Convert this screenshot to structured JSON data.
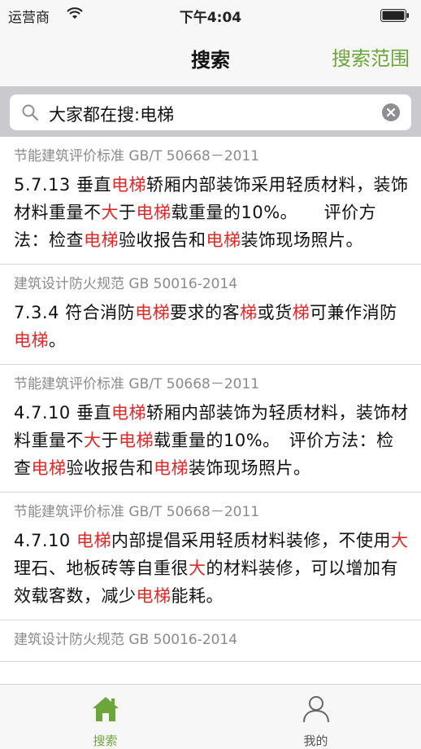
{
  "status": {
    "carrier": "运营商",
    "time": "下午4:04"
  },
  "nav": {
    "title": "搜索",
    "scope_button": "搜索范围"
  },
  "search": {
    "value": "大家都在搜:电梯"
  },
  "results": [
    {
      "source": "节能建筑评价标准 GB/T 50668－2011",
      "segments": [
        {
          "t": "5.7.13 垂直"
        },
        {
          "t": "电梯",
          "h": 1
        },
        {
          "t": "轿厢内部装饰采用轻质材料，装饰材料重量不"
        },
        {
          "t": "大",
          "h": 1
        },
        {
          "t": "于"
        },
        {
          "t": "电梯",
          "h": 1
        },
        {
          "t": "载重量的10%。　　评价方法：检查"
        },
        {
          "t": "电梯",
          "h": 1
        },
        {
          "t": "验收报告和"
        },
        {
          "t": "电梯",
          "h": 1
        },
        {
          "t": "装饰现场照片。"
        }
      ]
    },
    {
      "source": "建筑设计防火规范 GB 50016-2014",
      "segments": [
        {
          "t": "7.3.4 符合消防"
        },
        {
          "t": "电梯",
          "h": 1
        },
        {
          "t": "要求的客"
        },
        {
          "t": "梯",
          "h": 1
        },
        {
          "t": "或货"
        },
        {
          "t": "梯",
          "h": 1
        },
        {
          "t": "可兼作消防"
        },
        {
          "t": "电梯",
          "h": 1
        },
        {
          "t": "。"
        }
      ]
    },
    {
      "source": "节能建筑评价标准 GB/T 50668－2011",
      "segments": [
        {
          "t": "4.7.10 垂直"
        },
        {
          "t": "电梯",
          "h": 1
        },
        {
          "t": "轿厢内部装饰为轻质材料，装饰材料重量不"
        },
        {
          "t": "大",
          "h": 1
        },
        {
          "t": "于"
        },
        {
          "t": "电梯",
          "h": 1
        },
        {
          "t": "载重量的10%。　评价方法：检查"
        },
        {
          "t": "电梯",
          "h": 1
        },
        {
          "t": "验收报告和"
        },
        {
          "t": "电梯",
          "h": 1
        },
        {
          "t": "装饰现场照片。"
        }
      ]
    },
    {
      "source": "节能建筑评价标准 GB/T 50668－2011",
      "segments": [
        {
          "t": "4.7.10 "
        },
        {
          "t": "电梯",
          "h": 1
        },
        {
          "t": "内部提倡采用轻质材料装修，不使用"
        },
        {
          "t": "大",
          "h": 1
        },
        {
          "t": "理石、地板砖等自重很"
        },
        {
          "t": "大",
          "h": 1
        },
        {
          "t": "的材料装修，可以增加有效载客数，减少"
        },
        {
          "t": "电梯",
          "h": 1
        },
        {
          "t": "能耗。"
        }
      ]
    },
    {
      "source": "建筑设计防火规范 GB 50016-2014",
      "segments": []
    }
  ],
  "tabs": [
    {
      "label": "搜索",
      "icon": "home-icon",
      "active": true
    },
    {
      "label": "我的",
      "icon": "user-icon",
      "active": false
    }
  ],
  "colors": {
    "accent": "#6ca53a",
    "highlight": "#e02a2a"
  }
}
